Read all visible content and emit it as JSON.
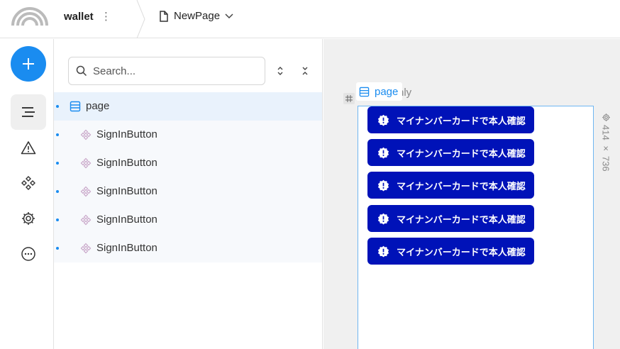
{
  "header": {
    "project_name": "wallet",
    "project_menu": "⋮",
    "page_name": "NewPage"
  },
  "rail": {
    "items": [
      "add-icon",
      "layers-icon",
      "warning-icon",
      "components-icon",
      "settings-icon",
      "more-icon"
    ]
  },
  "panel": {
    "search_placeholder": "Search...",
    "tree": [
      {
        "label": "page",
        "kind": "page",
        "selected": true
      },
      {
        "label": "SignInButton",
        "kind": "component"
      },
      {
        "label": "SignInButton",
        "kind": "component"
      },
      {
        "label": "SignInButton",
        "kind": "component"
      },
      {
        "label": "SignInButton",
        "kind": "component"
      },
      {
        "label": "SignInButton",
        "kind": "component"
      }
    ]
  },
  "canvas": {
    "frame_label": "page",
    "ghost_text": "nly",
    "size_label": "414 × 736",
    "buttons": [
      {
        "label": "マイナンバーカードで本人確認"
      },
      {
        "label": "マイナンバーカードで本人確認"
      },
      {
        "label": "マイナンバーカードで本人確認"
      },
      {
        "label": "マイナンバーカードで本人確認"
      },
      {
        "label": "マイナンバーカードで本人確認"
      }
    ]
  },
  "colors": {
    "accent": "#1a8cf0",
    "button_bg": "#0012b8",
    "selected_row": "#e9f2fc"
  }
}
